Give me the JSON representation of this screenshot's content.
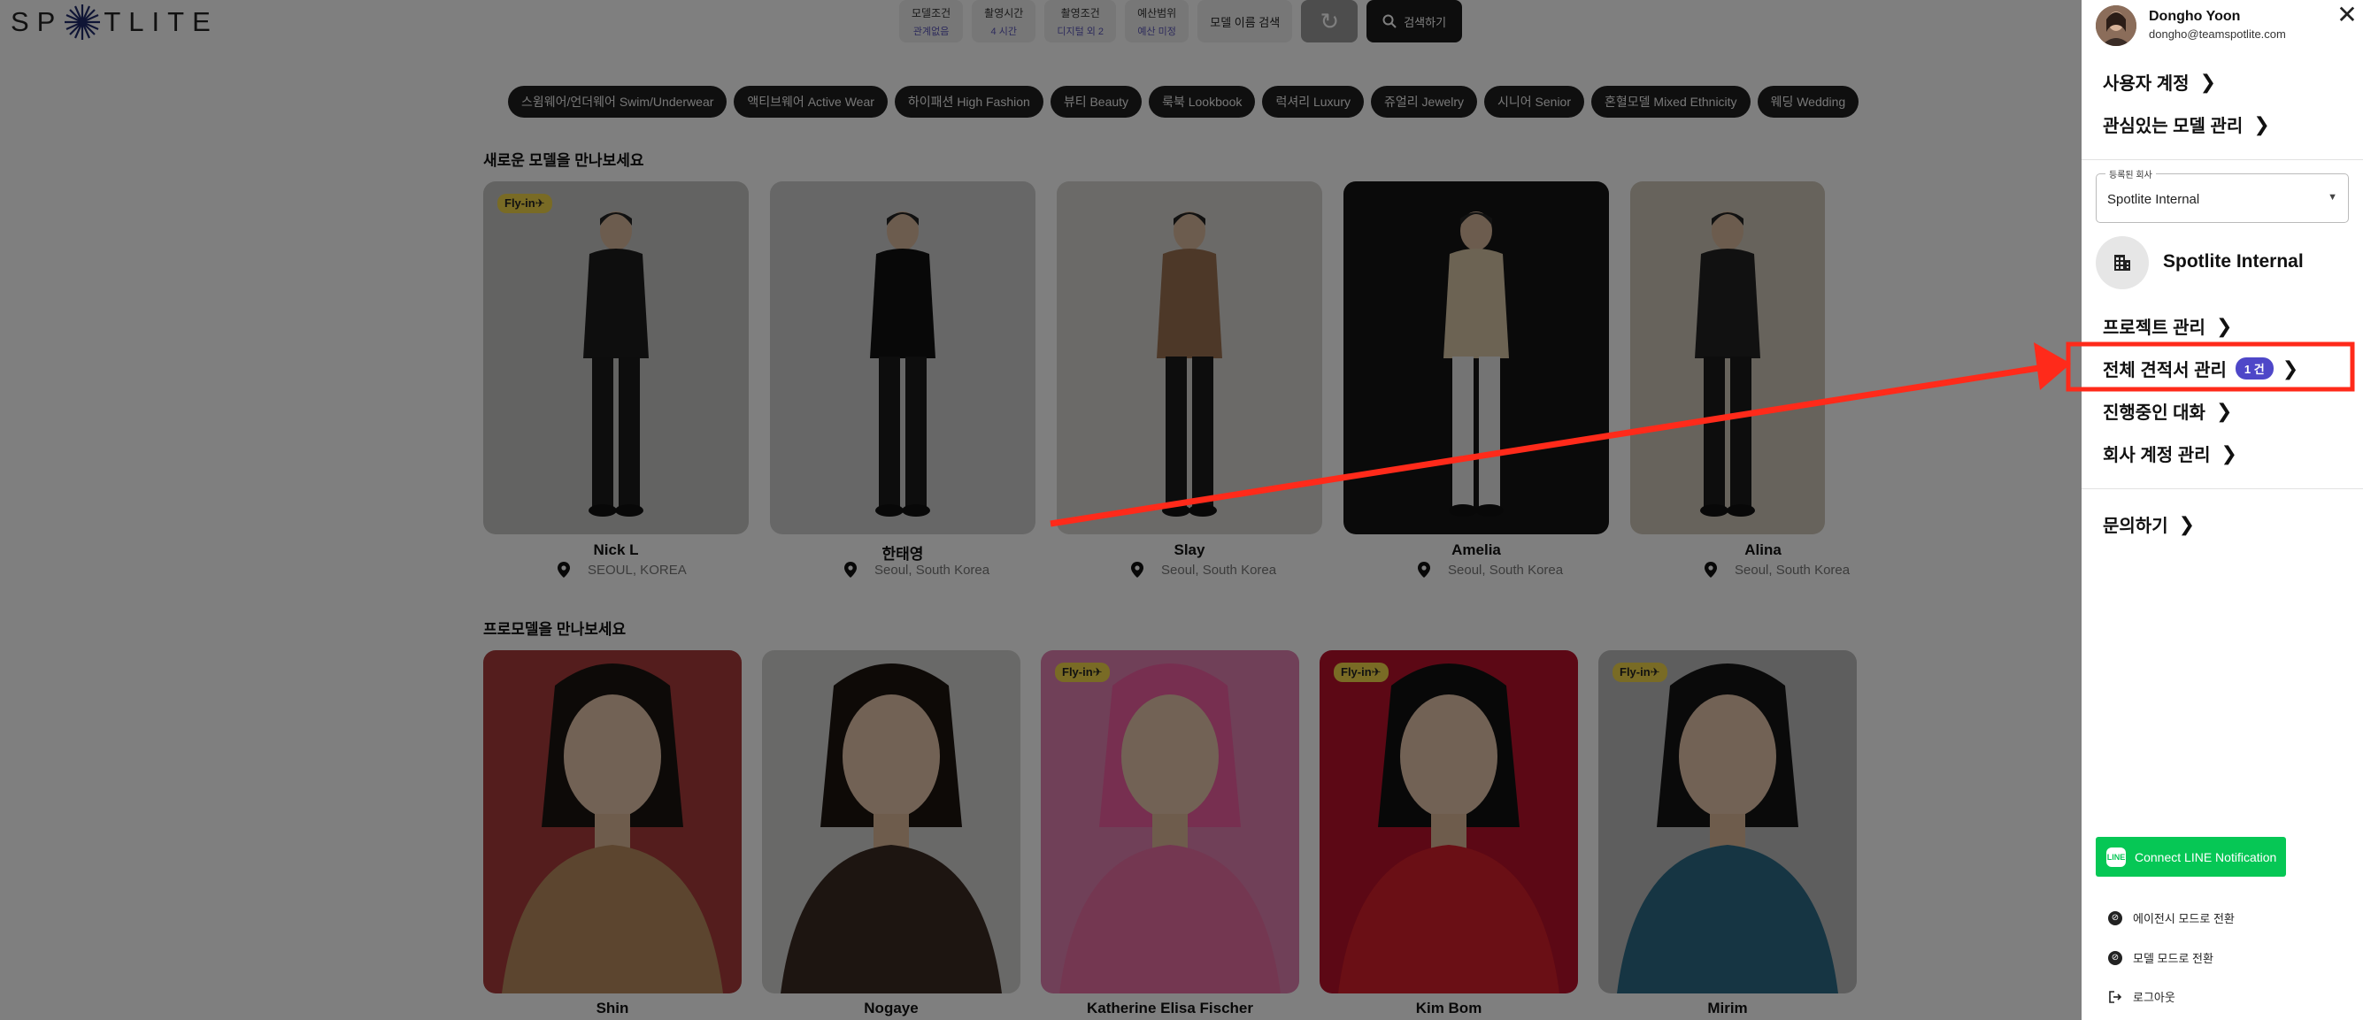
{
  "header": {
    "logo_text": "SP TLITE",
    "search": [
      {
        "title": "모델조건",
        "value": "관계없음"
      },
      {
        "title": "촬영시간",
        "value": "4 시간"
      },
      {
        "title": "촬영조건",
        "value": "디지털 외 2"
      },
      {
        "title": "예산범위",
        "value": "예산 미정"
      }
    ],
    "name_search_label": "모델 이름 검색",
    "refresh_icon": "refresh-icon",
    "search_button_label": "검색하기"
  },
  "categories": [
    "스윔웨어/언더웨어 Swim/Underwear",
    "액티브웨어 Active Wear",
    "하이패션 High Fashion",
    "뷰티 Beauty",
    "룩북 Lookbook",
    "럭셔리 Luxury",
    "쥬얼리 Jewelry",
    "시니어 Senior",
    "혼혈모델 Mixed Ethnicity",
    "웨딩 Wedding"
  ],
  "new_models": {
    "title": "새로운 모델을 만나보세요",
    "items": [
      {
        "name": "Nick L",
        "location": "SEOUL, KOREA",
        "badge": "Fly-in✈",
        "bg": "#c7c7c5",
        "fig": "#1c1c1c"
      },
      {
        "name": "한태영",
        "location": "Seoul, South Korea",
        "badge": "",
        "bg": "#cfcfcf",
        "fig": "#111111"
      },
      {
        "name": "Slay",
        "location": "Seoul, South Korea",
        "badge": "",
        "bg": "#d6d4d0",
        "fig": "#9b7150"
      },
      {
        "name": "Amelia",
        "location": "Seoul, South Korea",
        "badge": "",
        "bg": "#151515",
        "fig": "#d9c6a6"
      },
      {
        "name": "Alina",
        "location": "Seoul, South Korea",
        "badge": "",
        "bg": "#cfc6b8",
        "fig": "#222222"
      }
    ]
  },
  "pro_models": {
    "title": "프로모델을 만나보세요",
    "items": [
      {
        "name": "Shin",
        "badge": "",
        "bg": "#a83a3a",
        "fig": "#b98a5e"
      },
      {
        "name": "Nogaye",
        "badge": "",
        "bg": "#d2d2d0",
        "fig": "#3b2a22"
      },
      {
        "name": "Katherine Elisa Fischer",
        "badge": "Fly-in✈",
        "bg": "#e080b0",
        "fig": "#e86fa3"
      },
      {
        "name": "Kim Bom",
        "badge": "Fly-in✈",
        "bg": "#b8102a",
        "fig": "#d41e2a"
      },
      {
        "name": "Mirim",
        "badge": "Fly-in✈",
        "bg": "#bdbdbd",
        "fig": "#2d6b86"
      }
    ]
  },
  "panel": {
    "user_name": "Dongho Yoon",
    "user_email": "dongho@teamspotlite.com",
    "close_icon": "close-icon",
    "user_account": "사용자 계정",
    "interested_models": "관심있는 모델 관리",
    "company_label": "등록된 회사",
    "company_value": "Spotlite Internal",
    "company_name": "Spotlite Internal",
    "project_mgmt": "프로젝트 관리",
    "all_quotes": "전체 견적서 관리",
    "quote_count": "1 건",
    "ongoing_chats": "진행중인 대화",
    "company_accounts": "회사 계정 관리",
    "inquiry": "문의하기",
    "line_button": "Connect LINE Notification",
    "line_logo": "LINE",
    "agency_mode": "에이전시 모드로 전환",
    "model_mode": "모델 모드로 전환",
    "logout": "로그아웃"
  },
  "annotation": {
    "color": "#ff2a1a"
  }
}
